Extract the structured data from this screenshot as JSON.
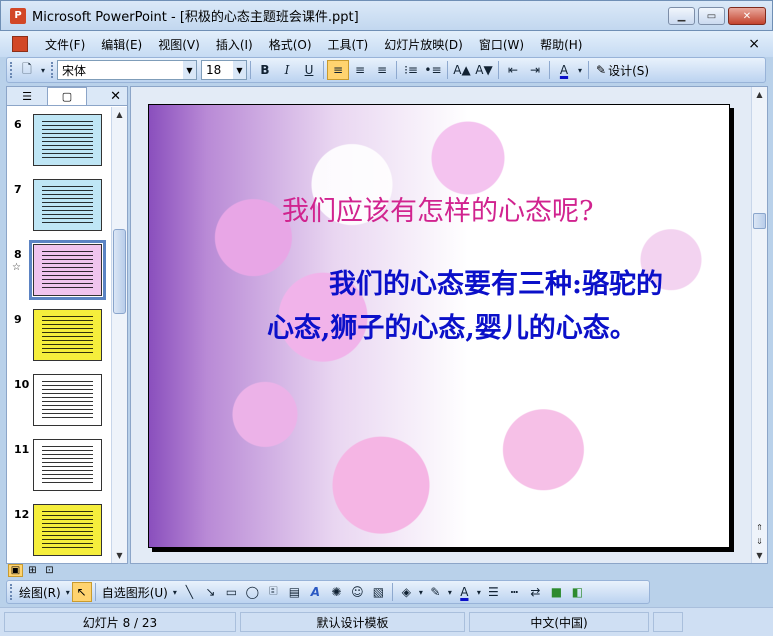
{
  "window": {
    "title": "Microsoft PowerPoint - [积极的心态主题班会课件.ppt]",
    "app_icon": "powerpoint-icon"
  },
  "menubar": {
    "items": [
      "文件(F)",
      "编辑(E)",
      "视图(V)",
      "插入(I)",
      "格式(O)",
      "工具(T)",
      "幻灯片放映(D)",
      "窗口(W)",
      "帮助(H)"
    ],
    "close": "×"
  },
  "toolbar": {
    "font_name": "宋体",
    "font_size": "18",
    "bold": "B",
    "italic": "I",
    "underline": "U",
    "design_label": "设计(S)"
  },
  "slides_pane": {
    "thumbnails": [
      {
        "number": "6",
        "bg": "#bfe6f5"
      },
      {
        "number": "7",
        "bg": "#bfe6f5"
      },
      {
        "number": "8",
        "bg": "#f0c4ee",
        "selected": true,
        "has_animation": true
      },
      {
        "number": "9",
        "bg": "#f5ee3c"
      },
      {
        "number": "10",
        "bg": "#ffffff"
      },
      {
        "number": "11",
        "bg": "#ffffff"
      },
      {
        "number": "12",
        "bg": "#f5ee3c"
      }
    ],
    "selected_star": "☆"
  },
  "slide": {
    "title": "我们应该有怎样的心态呢?",
    "body": "我们的心态要有三种:骆驼的心态,狮子的心态,婴儿的心态。",
    "title_color": "#d1238f",
    "body_color": "#0b10c9"
  },
  "drawing_toolbar": {
    "draw_label": "绘图(R)",
    "autoshapes_label": "自选图形(U)"
  },
  "statusbar": {
    "slide_info": "幻灯片 8 / 23",
    "template": "默认设计模板",
    "language": "中文(中国)"
  }
}
